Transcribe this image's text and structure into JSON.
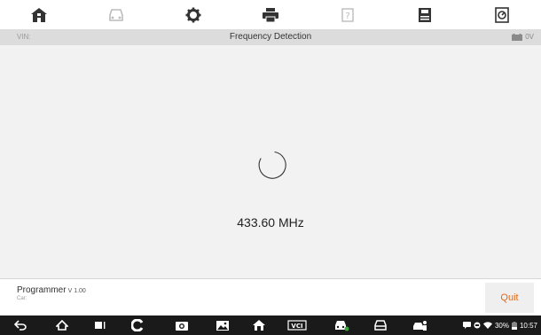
{
  "toolbar": {
    "buttons": [
      {
        "icon": "home-icon",
        "enabled": true
      },
      {
        "icon": "vehicle-icon",
        "enabled": false
      },
      {
        "icon": "settings-icon",
        "enabled": true
      },
      {
        "icon": "print-icon",
        "enabled": true
      },
      {
        "icon": "help-icon",
        "enabled": false
      },
      {
        "icon": "save-icon",
        "enabled": true
      },
      {
        "icon": "data-logging-icon",
        "enabled": true
      }
    ]
  },
  "infobar": {
    "vin_label": "VIN:",
    "title": "Frequency Detection",
    "voltage": "0V"
  },
  "main": {
    "frequency": "433.60 MHz"
  },
  "footer": {
    "app_name": "Programmer",
    "version": "V 1.00",
    "car_label": "Car:",
    "quit_label": "Quit"
  },
  "navbar": {
    "items": [
      "back-icon",
      "home-icon",
      "recent-apps-icon",
      "chrome-icon",
      "camera-icon",
      "gallery-icon",
      "maxisys-home-icon",
      "vci-icon",
      "vehicle-wifi-icon",
      "car-icon",
      "service-icon"
    ],
    "battery": "30%",
    "time": "10:57"
  },
  "colors": {
    "accent": "#e06a1a",
    "infobar_bg": "#dcdcdc",
    "content_bg": "#f2f2f2",
    "navbar_bg": "#1a1a1a"
  }
}
